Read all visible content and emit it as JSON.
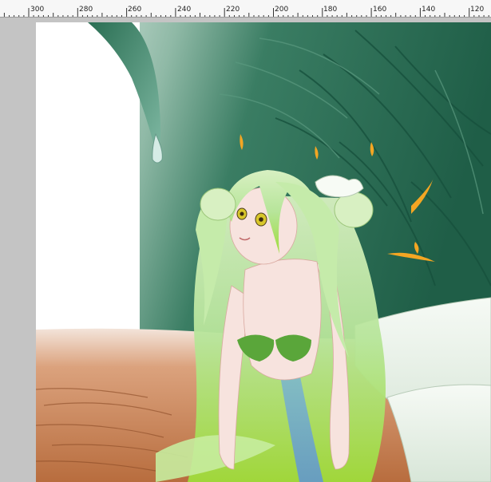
{
  "ruler": {
    "labels": [
      "300",
      "280",
      "260",
      "240",
      "220",
      "200",
      "180",
      "160",
      "140",
      "120"
    ]
  },
  "canvas": {
    "content": "illustration",
    "palette": {
      "background_dark_green": "#1f5e47",
      "background_mid_green": "#3a7d63",
      "floor_orange": "#c98354",
      "hair_green": "#b7e59a",
      "hair_highlight": "#eaf7c9",
      "skin": "#f7e3de",
      "bikini_green": "#5aa63a",
      "tail_white": "#eef4ee",
      "petal_orange": "#f4a623"
    }
  },
  "colors": {
    "ruler_bg": "#f7f7f7",
    "workspace_bg": "#c4c4c4"
  }
}
